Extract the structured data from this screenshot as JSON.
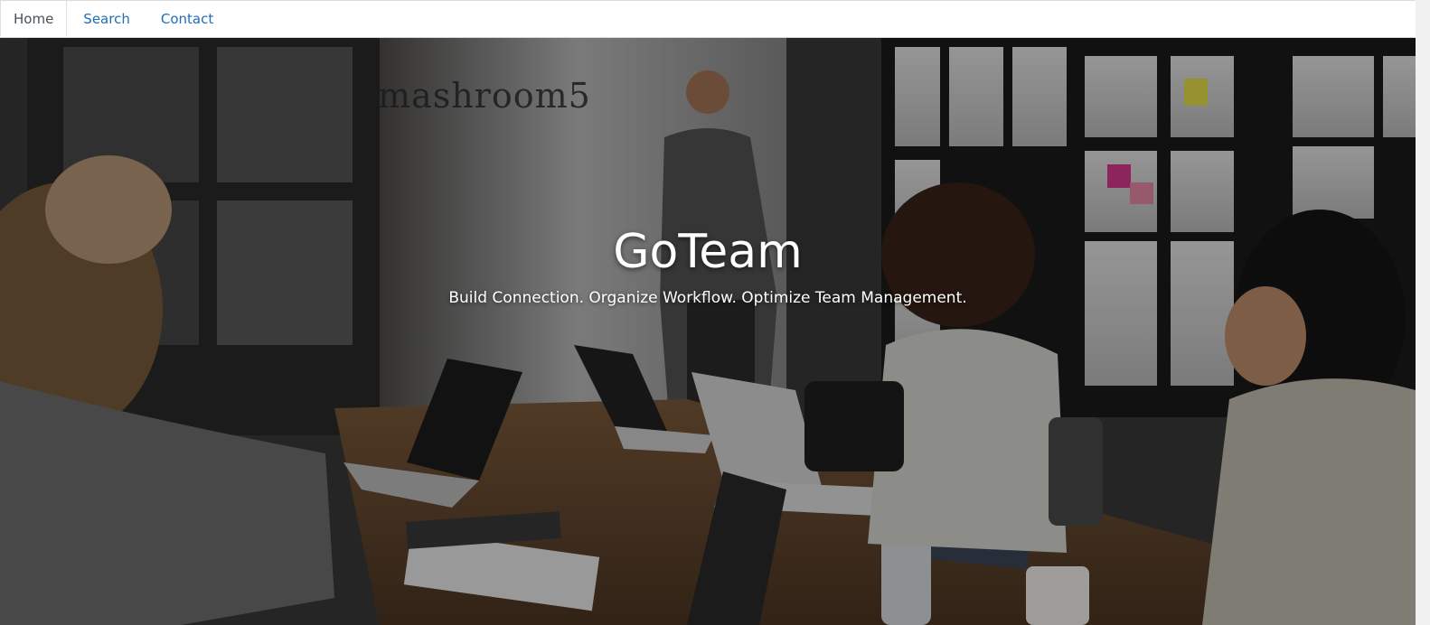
{
  "nav": {
    "tabs": [
      {
        "label": "Home",
        "active": true
      },
      {
        "label": "Search",
        "active": false
      },
      {
        "label": "Contact",
        "active": false
      }
    ],
    "link_color": "#1f6fb5",
    "active_color": "#495057"
  },
  "hero": {
    "title": "GoTeam",
    "subtitle": "Build Connection. Organize Workflow. Optimize Team Management.",
    "background_photo": "office-meeting-photo",
    "wall_sign_text": "mashroom5"
  }
}
